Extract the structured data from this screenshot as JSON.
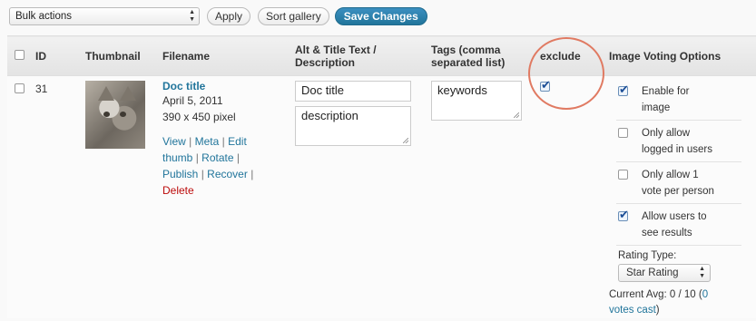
{
  "toolbar": {
    "bulk_select_value": "Bulk actions",
    "apply_label": "Apply",
    "sort_label": "Sort gallery",
    "save_label": "Save Changes"
  },
  "columns": {
    "id": "ID",
    "thumbnail": "Thumbnail",
    "filename": "Filename",
    "alt_line1": "Alt & Title Text /",
    "alt_line2": "Description",
    "tags_line1": "Tags (comma",
    "tags_line2": "separated list)",
    "exclude": "exclude",
    "voting": "Image Voting Options"
  },
  "row": {
    "id": "31",
    "title": "Doc title",
    "date": "April 5, 2011",
    "dimensions": "390 x 450 pixel",
    "actions": {
      "view": "View",
      "meta": "Meta",
      "edit_thumb_1": "Edit",
      "edit_thumb_2": "thumb",
      "rotate": "Rotate",
      "publish": "Publish",
      "recover": "Recover",
      "delete": "Delete",
      "sep": "|"
    },
    "alt_value": "Doc title",
    "description_value": "description",
    "tags_value": "keywords",
    "exclude_checked": true,
    "voting": {
      "enable_line1": "Enable for",
      "enable_line2": "image",
      "logged_line1": "Only allow",
      "logged_line2": "logged in users",
      "once_line1": "Only allow 1",
      "once_line2": "vote per person",
      "results_line1": "Allow users to",
      "results_line2": "see results",
      "enable_checked": true,
      "logged_checked": false,
      "once_checked": false,
      "results_checked": true,
      "rating_type_label": "Rating Type:",
      "rating_type_value": "Star Rating",
      "current_avg_text": "Current Avg: 0 / 10 (",
      "votes_link_1": "0",
      "votes_link_2": "votes cast",
      "votes_close": ")"
    }
  },
  "colors": {
    "accent": "#21759b",
    "delete": "#bc0b0b",
    "highlight_circle": "#e07a62"
  }
}
